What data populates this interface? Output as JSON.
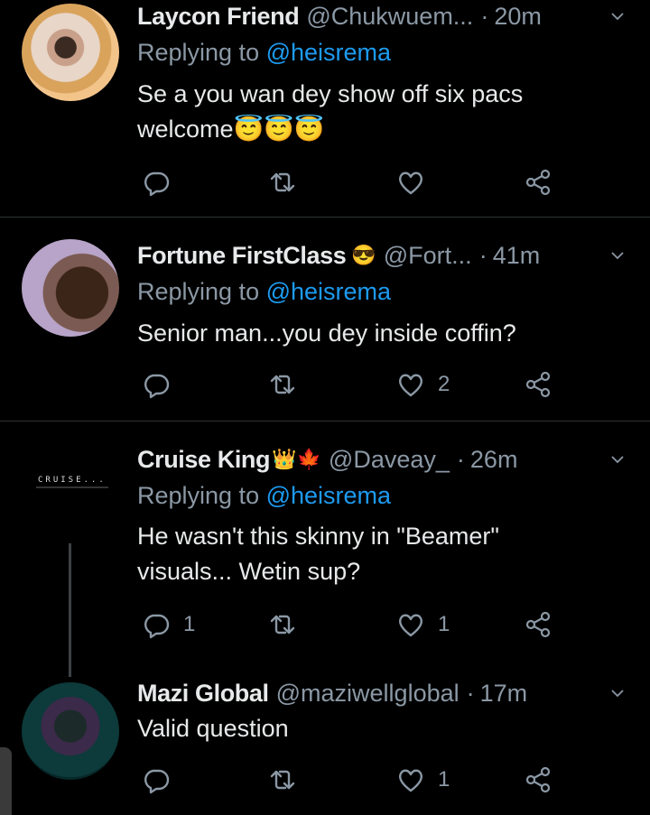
{
  "tweets": [
    {
      "name": "Laycon Friend",
      "name_emoji": "",
      "handle": "@Chukwuem...",
      "time": "20m",
      "replying_label": "Replying to",
      "replying_mention": "@heisrema",
      "text": "Se a you wan dey show off six pacs welcome😇😇😇",
      "replies": "",
      "retweets": "",
      "likes": ""
    },
    {
      "name": "Fortune FirstClass",
      "name_emoji": "😎",
      "handle": "@Fort...",
      "time": "41m",
      "replying_label": "Replying to",
      "replying_mention": "@heisrema",
      "text": "Senior man...you dey inside coffin?",
      "replies": "",
      "retweets": "",
      "likes": "2"
    },
    {
      "name": "Cruise King",
      "name_emoji": "👑🍁",
      "handle": "@Daveay_",
      "time": "26m",
      "avatar_text": "CRUISE...",
      "replying_label": "Replying to",
      "replying_mention": "@heisrema",
      "text": "He wasn't this skinny in \"Beamer\" visuals... Wetin sup?",
      "replies": "1",
      "retweets": "",
      "likes": "1"
    },
    {
      "name": "Mazi Global",
      "name_emoji": "",
      "handle": "@maziwellglobal",
      "time": "17m",
      "text": "Valid question",
      "replies": "",
      "retweets": "",
      "likes": "1"
    }
  ],
  "icons": {
    "reply": "reply-icon",
    "retweet": "retweet-icon",
    "like": "heart-icon",
    "share": "share-icon",
    "more": "chevron-down-icon"
  },
  "colors": {
    "background": "#000000",
    "primary_text": "#e7e9ea",
    "secondary_text": "#8b98a5",
    "mention": "#1d9bf0",
    "divider": "#2f3336"
  }
}
